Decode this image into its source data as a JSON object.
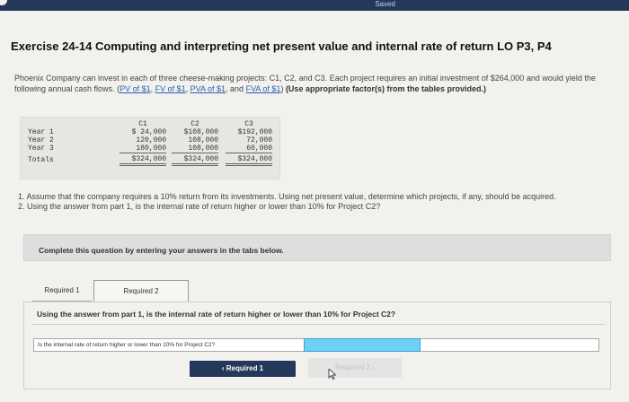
{
  "status": {
    "saved": "Saved"
  },
  "exercise": {
    "title": "Exercise 24-14 Computing and interpreting net present value and internal rate of return LO P3, P4",
    "description_1": "Phoenix Company can invest in each of three cheese-making projects: C1, C2, and C3. Each project requires an initial investment of $264,000 and would yield the following annual cash flows.",
    "links": [
      "PV of $1",
      "FV of $1",
      "PVA of $1",
      "FVA of $1"
    ],
    "description_note": "(Use appropriate factor(s) from the tables provided.)"
  },
  "cash_flow_table": {
    "columns": [
      "C1",
      "C2",
      "C3"
    ],
    "rows": [
      {
        "label": "Year 1",
        "values": [
          "$ 24,000",
          "$108,000",
          "$192,000"
        ]
      },
      {
        "label": "Year 2",
        "values": [
          "120,000",
          "108,000",
          "72,000"
        ]
      },
      {
        "label": "Year 3",
        "values": [
          "180,000",
          "108,000",
          "60,000"
        ]
      },
      {
        "label": "Totals",
        "values": [
          "$324,000",
          "$324,000",
          "$324,000"
        ]
      }
    ]
  },
  "questions": {
    "q1": "1. Assume that the company requires a 10% return from its investments. Using net present value, determine which projects, if any, should be acquired.",
    "q2": "2. Using the answer from part 1, is the internal rate of return higher or lower than 10% for Project C2?"
  },
  "instruction": "Complete this question by entering your answers in the tabs below.",
  "tabs": [
    {
      "label": "Required 1",
      "active": false
    },
    {
      "label": "Required 2",
      "active": true
    }
  ],
  "required2": {
    "question": "Using the answer from part 1, is the internal rate of return higher or lower than 10% for Project C2?",
    "answer_label": "Is the internal rate of return higher or lower than 10% for Project C2?",
    "answer_value": ""
  },
  "nav": {
    "prev_label": "Required 1",
    "next_label": "Required 2"
  },
  "colors": {
    "navy": "#23385a",
    "select_fill": "#6fd0f5",
    "link": "#2a5fb0"
  }
}
